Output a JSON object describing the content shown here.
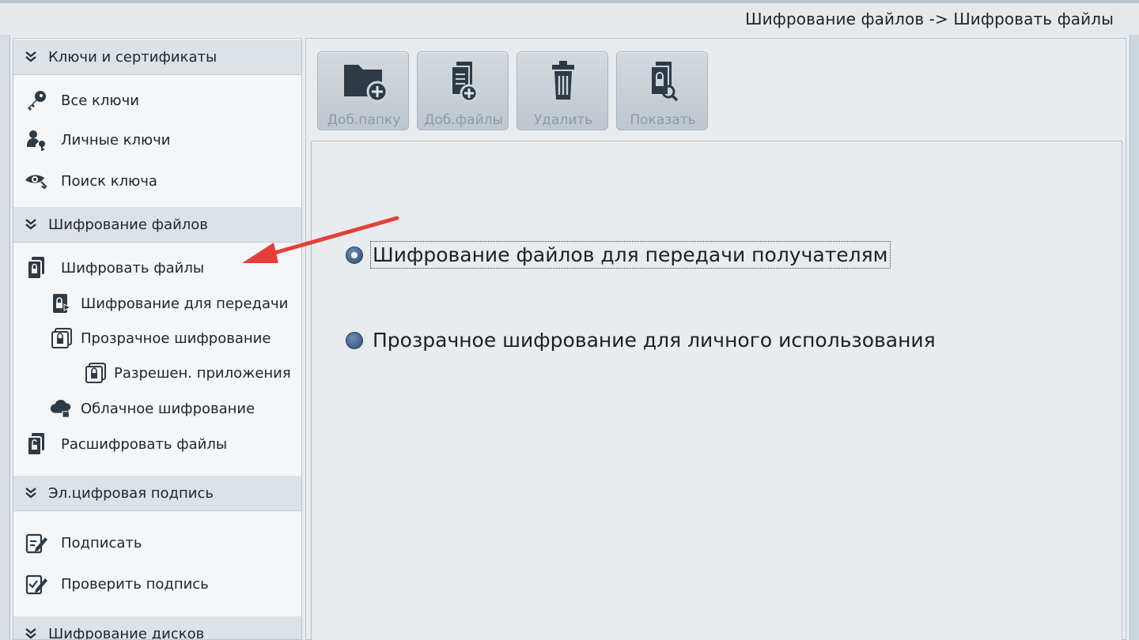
{
  "header": {
    "breadcrumb": "Шифрование файлов -> Шифровать файлы"
  },
  "sidebar": {
    "keys_section": {
      "title": "Ключи и сертификаты",
      "items": [
        "Все ключи",
        "Личные ключи",
        "Поиск ключа"
      ]
    },
    "file_enc_section": {
      "title": "Шифрование файлов",
      "encrypt_files": "Шифровать файлы",
      "enc_transfer": "Шифрование для передачи",
      "transparent": "Прозрачное шифрование",
      "allowed_apps": "Разрешен. приложения",
      "cloud": "Облачное шифрование",
      "decrypt_files": "Расшифровать файлы"
    },
    "signature_section": {
      "title": "Эл.цифровая подпись",
      "items": [
        "Подписать",
        "Проверить подпись"
      ]
    },
    "disk_section": {
      "title": "Шифрование дисков"
    }
  },
  "toolbar": {
    "add_folder": "Доб.папку",
    "add_files": "Доб.файлы",
    "delete": "Удалить",
    "show": "Показать"
  },
  "main": {
    "options": [
      {
        "label": "Шифрование файлов для передачи получателям",
        "selected": true
      },
      {
        "label": "Прозрачное шифрование для личного использования",
        "selected": false
      }
    ]
  },
  "colors": {
    "accent_arrow": "#e3403a",
    "icon_dark": "#2e3a46",
    "radio_blue": "#2b4a72"
  }
}
